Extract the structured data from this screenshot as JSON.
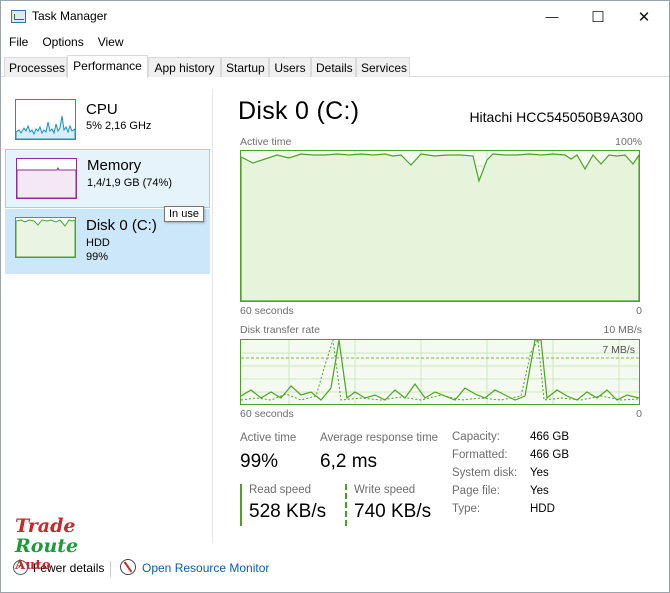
{
  "window": {
    "title": "Task Manager",
    "minimize_glyph": "—",
    "maximize_glyph": "☐",
    "close_glyph": "✕"
  },
  "menu": [
    "File",
    "Options",
    "View"
  ],
  "tabs": [
    {
      "label": "Processes",
      "active": false
    },
    {
      "label": "Performance",
      "active": true
    },
    {
      "label": "App history",
      "active": false
    },
    {
      "label": "Startup",
      "active": false
    },
    {
      "label": "Users",
      "active": false
    },
    {
      "label": "Details",
      "active": false
    },
    {
      "label": "Services",
      "active": false
    }
  ],
  "sidebar": {
    "cpu": {
      "title": "CPU",
      "subtitle": "5% 2,16 GHz"
    },
    "memory": {
      "title": "Memory",
      "subtitle": "1,4/1,9 GB (74%)"
    },
    "disk": {
      "title": "Disk 0 (C:)",
      "type": "HDD",
      "usage": "99%"
    }
  },
  "tooltip": "In use",
  "main": {
    "title": "Disk 0 (C:)",
    "model": "Hitachi HCC545050B9A300",
    "active_time_graph": {
      "label": "Active time",
      "max_label": "100%",
      "time_label": "60 seconds",
      "min_label": "0"
    },
    "transfer_graph": {
      "label": "Disk transfer rate",
      "max_label": "10 MB/s",
      "mid_label": "7 MB/s",
      "time_label": "60 seconds",
      "min_label": "0"
    },
    "stats": {
      "active_time_label": "Active time",
      "active_time_value": "99%",
      "response_label": "Average response time",
      "response_value": "6,2 ms",
      "read_label": "Read speed",
      "read_value": "528 KB/s",
      "write_label": "Write speed",
      "write_value": "740 KB/s"
    },
    "properties": [
      {
        "key": "Capacity:",
        "value": "466 GB"
      },
      {
        "key": "Formatted:",
        "value": "466 GB"
      },
      {
        "key": "System disk:",
        "value": "Yes"
      },
      {
        "key": "Page file:",
        "value": "Yes"
      },
      {
        "key": "Type:",
        "value": "HDD"
      }
    ]
  },
  "footer": {
    "fewer_details": "Fewer details",
    "open_monitor": "Open Resource Monitor"
  },
  "watermark": {
    "line1": "Trade",
    "line2": "Route",
    "line3": "Auto"
  },
  "colors": {
    "disk_green": "#4da226",
    "cpu_blue": "#1a8fc9",
    "memory_purple": "#8b2f96",
    "link_blue": "#0a5bb5",
    "selected_bg": "#cce6fa"
  }
}
